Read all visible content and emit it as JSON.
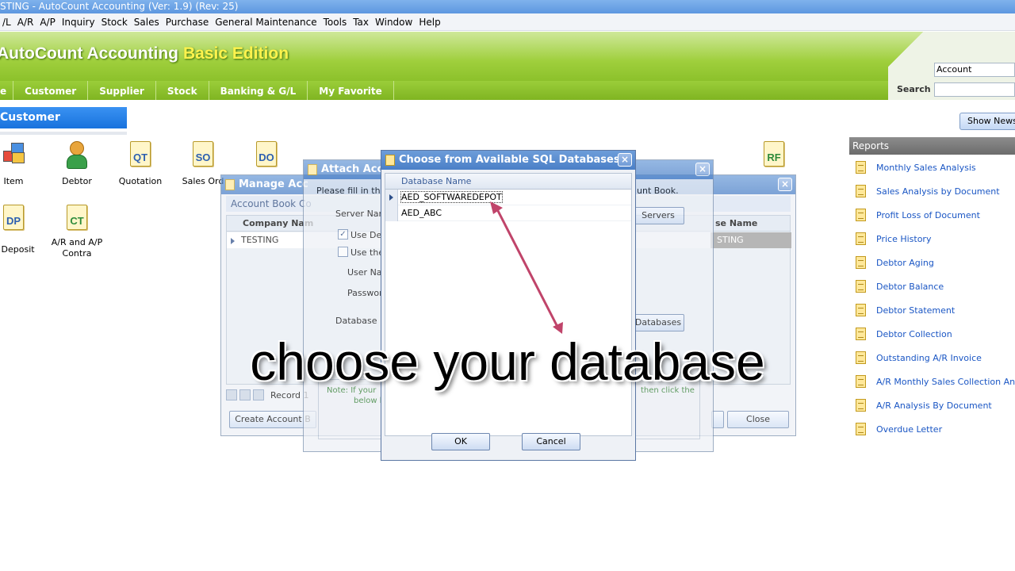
{
  "window": {
    "title": "STING - AutoCount Accounting (Ver: 1.9) (Rev: 25)"
  },
  "menubar": {
    "items": [
      "/L",
      "A/R",
      "A/P",
      "Inquiry",
      "Stock",
      "Sales",
      "Purchase",
      "General Maintenance",
      "Tools",
      "Tax",
      "Window",
      "Help"
    ]
  },
  "banner": {
    "brand": "AutoCount Accounting",
    "edition": "Basic Edition",
    "search_scope": "Account",
    "search_label": "Search :"
  },
  "module_tabs": [
    "e",
    "Customer",
    "Supplier",
    "Stock",
    "Banking & G/L",
    "My Favorite"
  ],
  "section": {
    "title": "Customer"
  },
  "icons": [
    {
      "label": "Item",
      "code": ""
    },
    {
      "label": "Debtor",
      "code": ""
    },
    {
      "label": "Quotation",
      "code": "QT"
    },
    {
      "label": "Sales Ord",
      "code": "SO"
    },
    {
      "label": "",
      "code": "DO"
    },
    {
      "label": "R Deposit",
      "code": "DP"
    },
    {
      "label": "A/R and A/P Contra",
      "code": "CT"
    },
    {
      "label": "",
      "code": "RF"
    }
  ],
  "reports": {
    "show_news": "Show News/",
    "header": "Reports",
    "items": [
      "Monthly Sales Analysis",
      "Sales Analysis by Document",
      "Profit  Loss of Document",
      "Price History",
      "Debtor Aging",
      "Debtor Balance",
      "Debtor Statement",
      "Debtor Collection",
      "Outstanding A/R Invoice",
      "A/R Monthly Sales  Collection Analys",
      "A/R Analysis By Document",
      "Overdue Letter"
    ]
  },
  "manage_dialog": {
    "title": "Manage Acc",
    "subheader": "Account Book Co",
    "col_company": "Company Nam",
    "col_db": "se Name",
    "row_company": "TESTING",
    "row_db": "STING",
    "record": "Record 1",
    "create_btn": "Create Account B",
    "close_btn": "Close"
  },
  "attach_dialog": {
    "title": "Attach Acc",
    "intro": "Please fill in the f",
    "intro_right": "unt Book.",
    "server_label": "Server Nam",
    "servers_btn": "Servers",
    "use_default": "Use Def",
    "use_the": "Use the",
    "user_label": "User Nan",
    "password_label": "Passwor",
    "db_label": "Database N",
    "databases_btn": "Databases",
    "note_left": "Note:  If your",
    "note_left2": "below b",
    "note_right": "then click the"
  },
  "choose_dialog": {
    "title": "Choose from Available SQL Databases",
    "column": "Database Name",
    "rows": [
      "AED_SOFTWAREDEPOT",
      "AED_ABC"
    ],
    "ok": "OK",
    "cancel": "Cancel"
  },
  "caption": "choose your database",
  "colors": {
    "banner_green": "#9fcf3c",
    "title_blue": "#4a7fc7",
    "link_blue": "#1a56c4",
    "arrow": "#c0446a"
  }
}
